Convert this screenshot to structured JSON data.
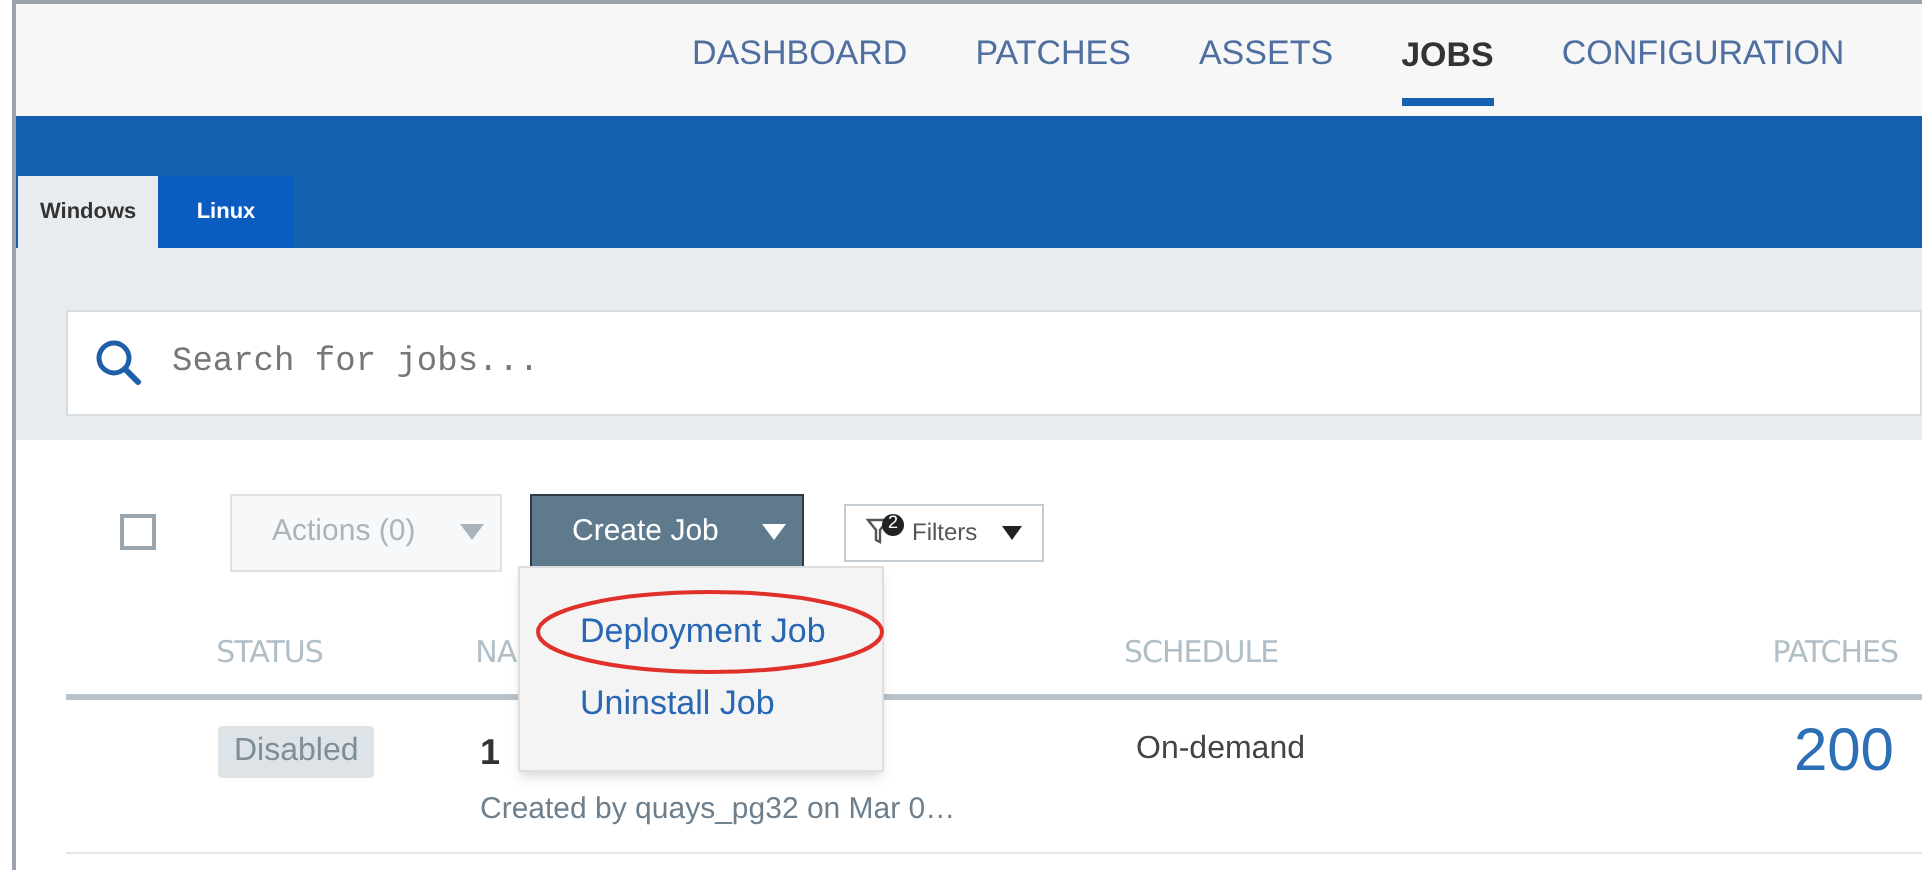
{
  "nav": [
    {
      "label": "DASHBOARD",
      "selected": false
    },
    {
      "label": "PATCHES",
      "selected": false
    },
    {
      "label": "ASSETS",
      "selected": false
    },
    {
      "label": "JOBS",
      "selected": true
    },
    {
      "label": "CONFIGURATION",
      "selected": false
    }
  ],
  "os_tabs": [
    {
      "label": "Windows",
      "selected": true
    },
    {
      "label": "Linux",
      "selected": false
    }
  ],
  "search": {
    "placeholder": "Search for jobs..."
  },
  "toolbar": {
    "select_all_checked": false,
    "actions": {
      "label": "Actions (0)",
      "disabled": true
    },
    "create_job": {
      "label": "Create Job",
      "expanded": true,
      "menu": [
        "Deployment Job",
        "Uninstall Job"
      ]
    },
    "filters": {
      "label": "Filters",
      "count": "2"
    }
  },
  "table": {
    "columns": [
      "STATUS",
      "NA",
      "SCHEDULE",
      "PATCHES"
    ],
    "rows": [
      {
        "status": "Disabled",
        "name": "1",
        "created": "Created by quays_pg32 on Mar 0…",
        "schedule": "On-demand",
        "patches": "200"
      }
    ]
  }
}
